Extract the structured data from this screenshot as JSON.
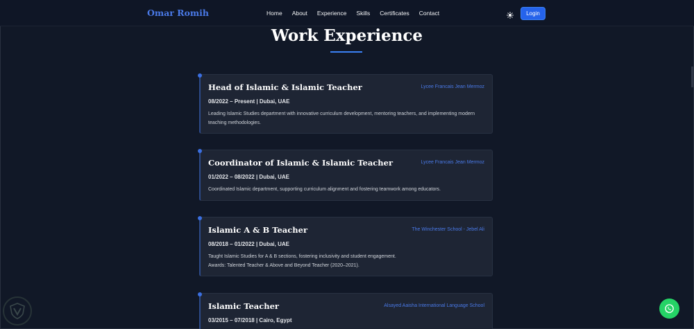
{
  "nav": {
    "brand": "Omar Romih",
    "links": [
      "Home",
      "About",
      "Experience",
      "Skills",
      "Certificates",
      "Contact"
    ],
    "login_label": "Login"
  },
  "section": {
    "title": "Work Experience"
  },
  "experience": [
    {
      "role": "Head of Islamic & Islamic Teacher",
      "company": "Lycee Francais Jean Mermoz",
      "meta": "08/2022 – Present | Dubai, UAE",
      "desc": [
        "Leading Islamic Studies department with innovative curriculum development, mentoring teachers, and implementing modern teaching methodologies."
      ]
    },
    {
      "role": "Coordinator of Islamic & Islamic Teacher",
      "company": "Lycee Francais Jean Mermoz",
      "meta": "01/2022 – 08/2022 | Dubai, UAE",
      "desc": [
        "Coordinated Islamic department, supporting curriculum alignment and fostering teamwork among educators."
      ]
    },
    {
      "role": "Islamic A & B Teacher",
      "company": "The Winchester School - Jebel Ali",
      "meta": "08/2018 – 01/2022 | Dubai, UAE",
      "desc": [
        "Taught Islamic Studies for A & B sections, fostering inclusivity and student engagement.",
        "Awards: Talented Teacher & Above and Beyond Teacher (2020–2021)."
      ]
    },
    {
      "role": "Islamic Teacher",
      "company": "Alsayed Aaisha International Language School",
      "meta": "03/2015 – 07/2018 | Cairo, Egypt",
      "desc": []
    }
  ],
  "icons": {
    "theme": "sun-icon",
    "whatsapp": "whatsapp-icon",
    "watermark": "shield-logo-icon"
  },
  "colors": {
    "background": "#111827",
    "accent": "#3b82f6",
    "card": "#1e2534",
    "whatsapp": "#25d366"
  }
}
